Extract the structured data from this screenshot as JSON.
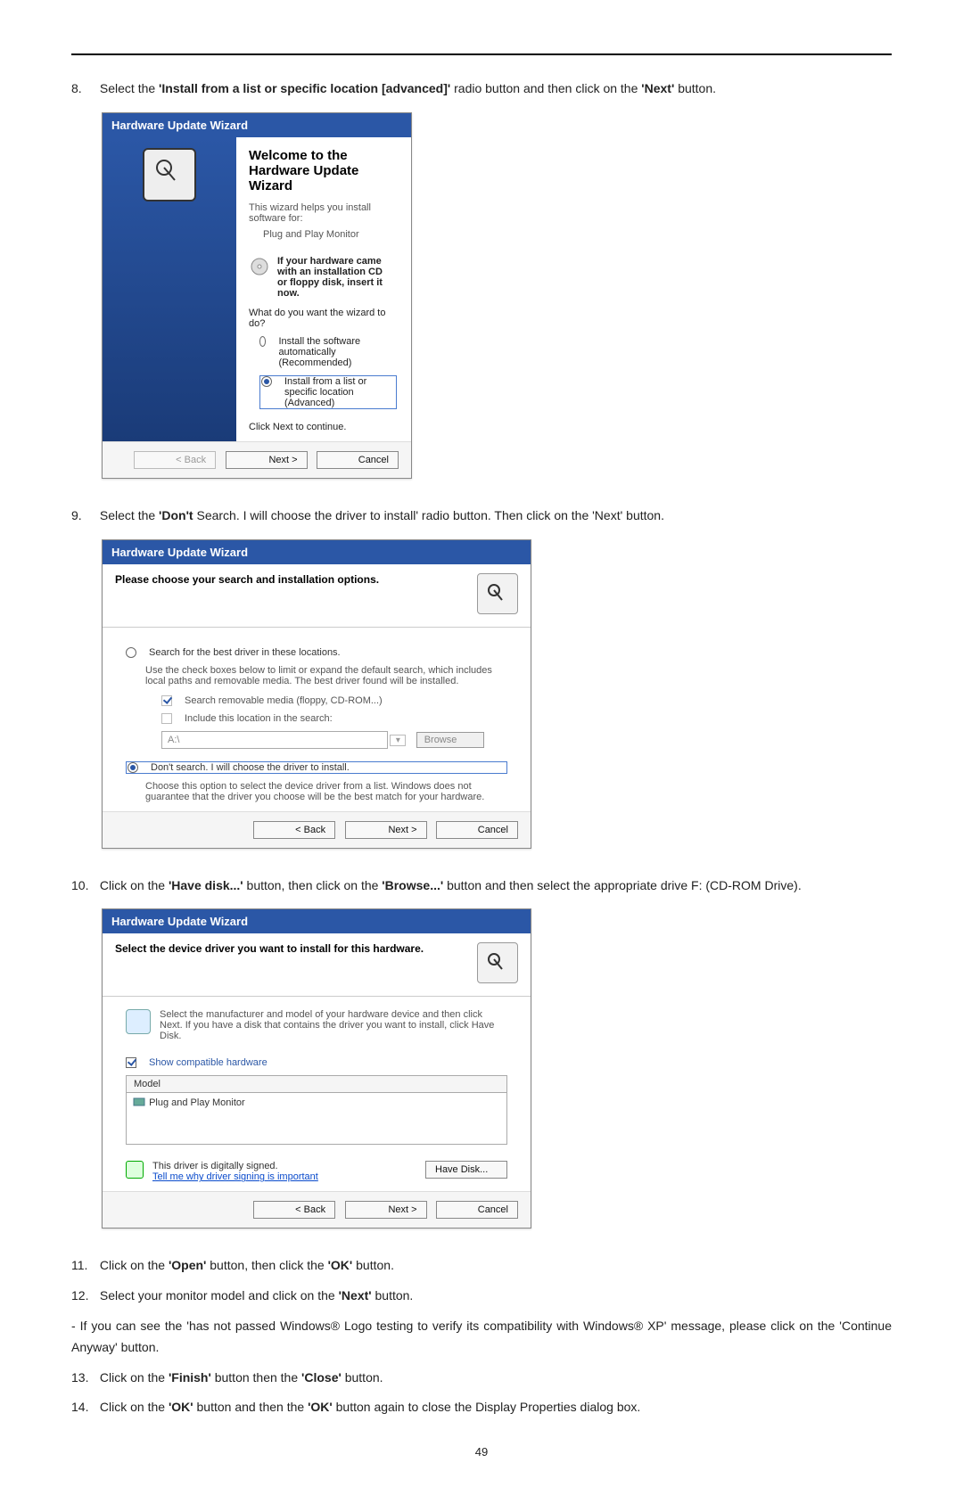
{
  "steps": {
    "s8": {
      "num": "8.",
      "pre": "Select the ",
      "b1": "'Install from a list or specific location [advanced]'",
      "mid": " radio button and then click on the ",
      "b2": "'Next'",
      "post": " button."
    },
    "s9": {
      "num": "9.",
      "pre": "Select the ",
      "b1": "'Don't ",
      "plain1": "Search. I will choose the driver to install' radio button. Then click on the 'Next' button."
    },
    "s10": {
      "num": "10.",
      "pre": "Click on the ",
      "b1": "'Have disk...'",
      "mid": " button, then click on the ",
      "b2": "'Browse...'",
      "post": " button and then select the appropriate drive F: (CD-ROM Drive)."
    },
    "s11": {
      "num": "11.",
      "pre": "Click on the ",
      "b1": "'Open'",
      "mid": " button, then click the ",
      "b2": "'OK'",
      "post": " button."
    },
    "s12": {
      "num": "12.",
      "pre": "Select your monitor model and click on the ",
      "b1": "'Next'",
      "post": " button."
    },
    "note": {
      "text": "- If you can see the 'has not passed Windows® Logo testing to verify its compatibility with Windows® XP' message, please click on the 'Continue Anyway' button."
    },
    "s13": {
      "num": "13.",
      "pre": "Click on the ",
      "b1": "'Finish'",
      "mid": " button then the ",
      "b2": "'Close'",
      "post": " button."
    },
    "s14": {
      "num": "14.",
      "pre": "Click on the ",
      "b1": "'OK'",
      "mid": " button and then the ",
      "b2": "'OK'",
      "post": " button again to close the Display Properties dialog box."
    }
  },
  "wizard1": {
    "title": "Hardware Update Wizard",
    "welcome": "Welcome to the Hardware Update Wizard",
    "help": "This wizard helps you install software for:",
    "device": "Plug and Play Monitor",
    "cdline1": "If your hardware came with an installation CD",
    "cdline2": "or floppy disk, insert it now.",
    "question": "What do you want the wizard to do?",
    "opt1": "Install the software automatically (Recommended)",
    "opt2": "Install from a list or specific location (Advanced)",
    "continue": "Click Next to continue.",
    "back": "< Back",
    "next": "Next >",
    "cancel": "Cancel"
  },
  "wizard2": {
    "title": "Hardware Update Wizard",
    "head": "Please choose your search and installation options.",
    "opt1": "Search for the best driver in these locations.",
    "opt1desc": "Use the check boxes below to limit or expand the default search, which includes local paths and removable media. The best driver found will be installed.",
    "chk1": "Search removable media (floppy, CD-ROM...)",
    "chk2": "Include this location in the search:",
    "path": "A:\\",
    "browse": "Browse",
    "opt2": "Don't search. I will choose the driver to install.",
    "opt2desc": "Choose this option to select the device driver from a list.  Windows does not guarantee that the driver you choose will be the best match for your hardware.",
    "back": "< Back",
    "next": "Next >",
    "cancel": "Cancel"
  },
  "wizard3": {
    "title": "Hardware Update Wizard",
    "head": "Select the device driver you want to install for this hardware.",
    "desc": "Select the manufacturer and model of your hardware device and then click Next. If you have a disk that contains the driver you want to install, click Have Disk.",
    "showcompat": "Show compatible hardware",
    "model_col": "Model",
    "model_row": "Plug and Play Monitor",
    "signed": "This driver is digitally signed.",
    "tell": "Tell me why driver signing is important",
    "havedisk": "Have Disk...",
    "back": "< Back",
    "next": "Next >",
    "cancel": "Cancel"
  },
  "page_number": "49"
}
